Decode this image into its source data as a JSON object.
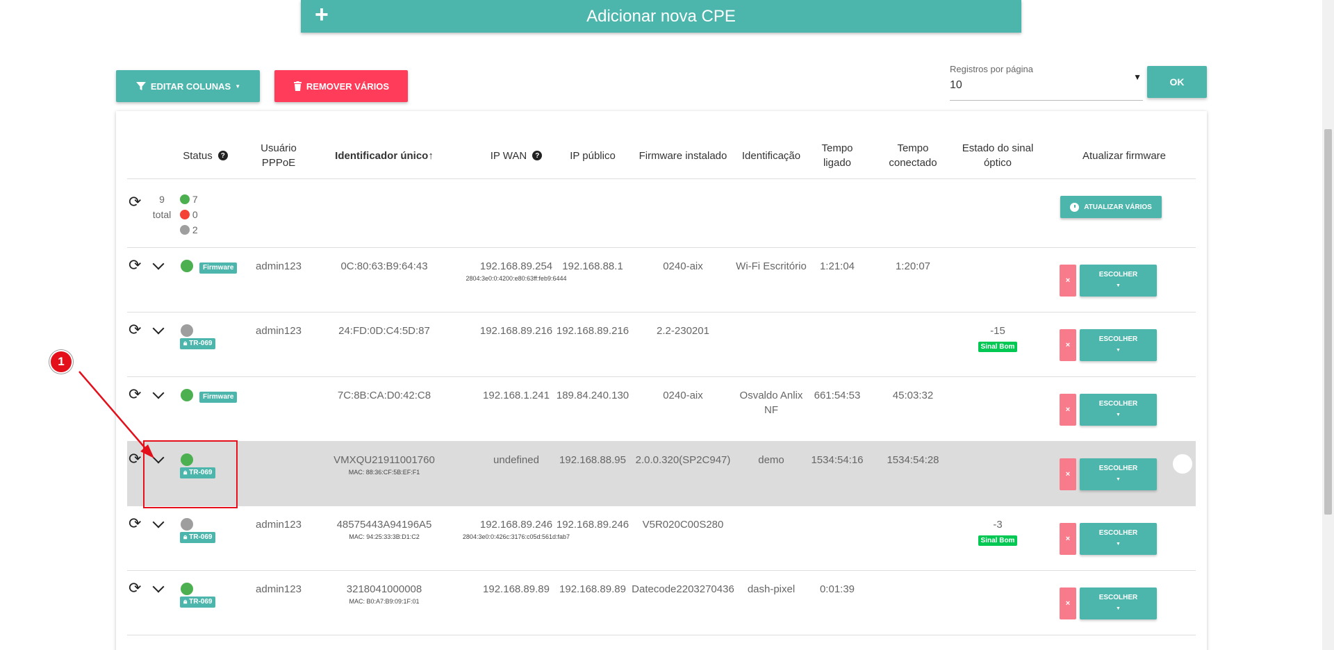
{
  "add_cpe_label": "Adicionar nova CPE",
  "toolbar": {
    "edit_columns": "EDITAR COLUNAS",
    "remove_many": "REMOVER VÁRIOS",
    "per_page_label": "Registros por página",
    "per_page_value": "10",
    "ok": "OK"
  },
  "headers": {
    "status": "Status",
    "pppoe_user_line1": "Usuário",
    "pppoe_user_line2": "PPPoE",
    "unique_id": "Identificador único↑",
    "ip_wan": "IP WAN",
    "public_ip": "IP público",
    "firmware": "Firmware instalado",
    "identification": "Identificação",
    "uptime_line1": "Tempo",
    "uptime_line2": "ligado",
    "connected_line1": "Tempo",
    "connected_line2": "conectado",
    "optical_line1": "Estado do sinal",
    "optical_line2": "óptico",
    "update_firmware": "Atualizar firmware"
  },
  "summary": {
    "total_count": "9",
    "total_label": "total",
    "online": "7",
    "offline": "0",
    "unknown": "2",
    "update_many": "ATUALIZAR VÁRIOS"
  },
  "rows": [
    {
      "status_color": "#4caf50",
      "tag": "Firmware",
      "user": "admin123",
      "id": "0C:80:63:B9:64:43",
      "id_sub": "",
      "wan": "192.168.89.254",
      "wan_sub": "2804:3e0:0:4200:e80:63ff:feb9:6444",
      "public_ip": "192.168.88.1",
      "firmware": "0240-aix",
      "ident_line1": "Wi-Fi Escritório",
      "ident_line2": "",
      "uptime": "1:21:04",
      "connected": "1:20:07",
      "signal": "",
      "signal_tag": "",
      "choose": "ESCOLHER",
      "remove": "×"
    },
    {
      "status_color": "#9e9e9e",
      "tag": "TR-069",
      "user": "admin123",
      "id": "24:FD:0D:C4:5D:87",
      "id_sub": "",
      "wan": "192.168.89.216",
      "wan_sub": "",
      "public_ip": "192.168.89.216",
      "firmware": "2.2-230201",
      "ident_line1": "",
      "ident_line2": "",
      "uptime": "",
      "connected": "",
      "signal": "-15",
      "signal_tag": "Sinal Bom",
      "choose": "ESCOLHER",
      "remove": "×"
    },
    {
      "status_color": "#4caf50",
      "tag": "Firmware",
      "user": "",
      "id": "7C:8B:CA:D0:42:C8",
      "id_sub": "",
      "wan": "192.168.1.241",
      "wan_sub": "",
      "public_ip": "189.84.240.130",
      "firmware": "0240-aix",
      "ident_line1": "Osvaldo Anlix",
      "ident_line2": "NF",
      "uptime": "661:54:53",
      "connected": "45:03:32",
      "signal": "",
      "signal_tag": "",
      "choose": "ESCOLHER",
      "remove": "×"
    },
    {
      "status_color": "#4caf50",
      "tag": "TR-069",
      "user": "",
      "id": "VMXQU21911001760",
      "id_sub": "MAC: 88:36:CF:5B:EF:F1",
      "wan": "undefined",
      "wan_sub": "",
      "public_ip": "192.168.88.95",
      "firmware": "2.0.0.320(SP2C947)",
      "ident_line1": "demo",
      "ident_line2": "",
      "uptime": "1534:54:16",
      "connected": "1534:54:28",
      "signal": "",
      "signal_tag": "",
      "choose": "ESCOLHER",
      "remove": "×"
    },
    {
      "status_color": "#9e9e9e",
      "tag": "TR-069",
      "user": "admin123",
      "id": "48575443A94196A5",
      "id_sub": "MAC: 94:25:33:3B:D1:C2",
      "wan": "192.168.89.246",
      "wan_sub": "2804:3e0:0:426c:3176:c05d:561d:fab7",
      "public_ip": "192.168.89.246",
      "firmware": "V5R020C00S280",
      "ident_line1": "",
      "ident_line2": "",
      "uptime": "",
      "connected": "",
      "signal": "-3",
      "signal_tag": "Sinal Bom",
      "choose": "ESCOLHER",
      "remove": "×"
    },
    {
      "status_color": "#4caf50",
      "tag": "TR-069",
      "user": "admin123",
      "id": "3218041000008",
      "id_sub": "MAC: B0:A7:B9:09:1F:01",
      "wan": "192.168.89.89",
      "wan_sub": "",
      "public_ip": "192.168.89.89",
      "firmware": "Datecode2203270436",
      "ident_line1": "dash-pixel",
      "ident_line2": "",
      "uptime": "0:01:39",
      "connected": "",
      "signal": "",
      "signal_tag": "",
      "choose": "ESCOLHER",
      "remove": "×"
    }
  ],
  "annotation": {
    "marker_number": "1"
  }
}
